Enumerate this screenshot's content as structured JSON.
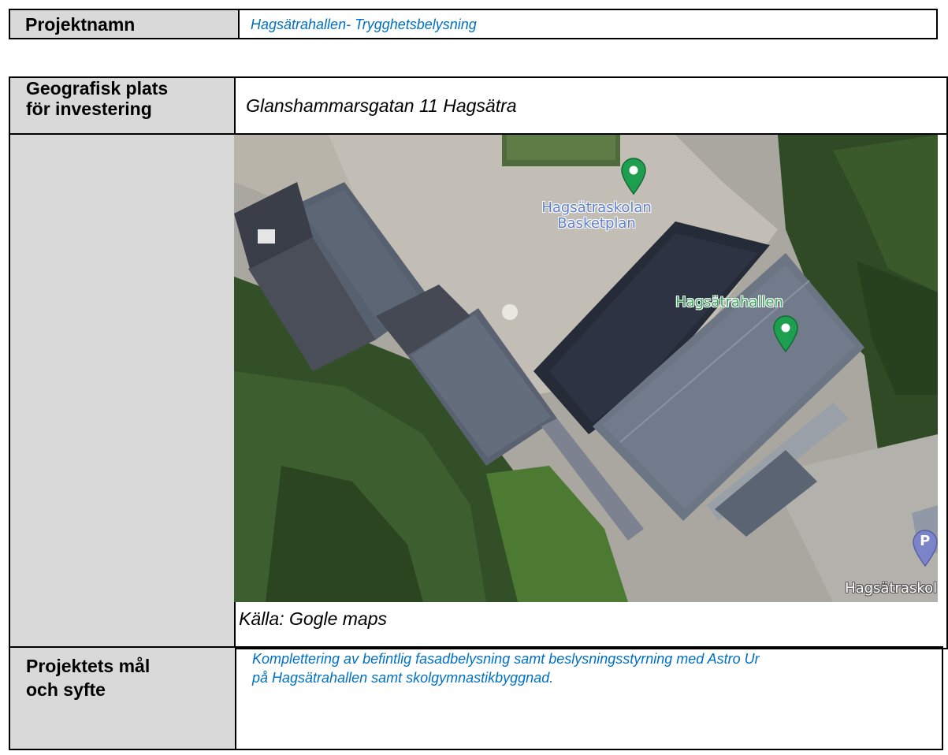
{
  "project": {
    "label": "Projektnamn",
    "value": "Hagsätrahallen- Trygghetsbelysning"
  },
  "location": {
    "label_line1": "Geografisk plats",
    "label_line2": "för investering",
    "value": "Glanshammarsgatan 11 Hagsätra",
    "map": {
      "labels": {
        "basketball_line1": "Hagsätraskolan",
        "basketball_line2": "Basketplan",
        "hall": "Hagsätrahallen",
        "school": "Hagsätraskol",
        "parking": "P"
      },
      "colors": {
        "pin_green": "#1e9e4f",
        "pin_purple": "#7b83c9"
      }
    },
    "caption": "Källa: Gogle maps"
  },
  "goals": {
    "label_line1": "Projektets mål",
    "label_line2": "och syfte",
    "value_line1": "Komplettering av befintlig fasadbelysning samt beslysningsstyrning med Astro Ur",
    "value_line2": "på Hagsätrahallen samt skolgymnastikbyggnad."
  }
}
